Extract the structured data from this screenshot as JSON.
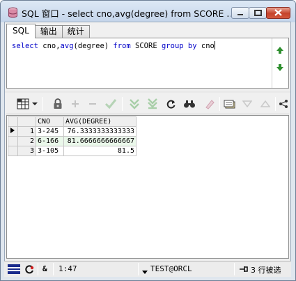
{
  "window": {
    "title": "SQL 窗口 - select cno,avg(degree) from SCORE ...",
    "buttons": {
      "minimize": "minimize",
      "maximize": "maximize",
      "close": "close"
    }
  },
  "tabs": [
    {
      "label": "SQL",
      "active": true
    },
    {
      "label": "输出",
      "active": false
    },
    {
      "label": "统计",
      "active": false
    }
  ],
  "editor": {
    "sql_parts": [
      "select",
      " cno,",
      "avg",
      "(degree) ",
      "from",
      " SCORE ",
      "group by",
      " cno"
    ]
  },
  "toolbar": {
    "icons": [
      "grid-view-icon",
      "lock-icon",
      "add-row-icon",
      "delete-row-icon",
      "post-changes-icon",
      "fetch-next-icon",
      "fetch-last-icon",
      "refresh-icon",
      "find-icon",
      "clear-icon",
      "export-icon",
      "sort-down-icon",
      "sort-up-icon",
      "connect-icon"
    ]
  },
  "grid": {
    "columns": [
      "CNO",
      "AVG(DEGREE)"
    ],
    "rows": [
      {
        "num": "1",
        "cno": "3-245",
        "avg": "76.3333333333333"
      },
      {
        "num": "2",
        "cno": "6-166",
        "avg": "81.6666666666667"
      },
      {
        "num": "3",
        "cno": "3-105",
        "avg": "81.5"
      }
    ]
  },
  "status": {
    "position": "1:47",
    "connection": "TEST@ORCL",
    "rows_info": "3 行被选",
    "ampersand": "&"
  }
}
